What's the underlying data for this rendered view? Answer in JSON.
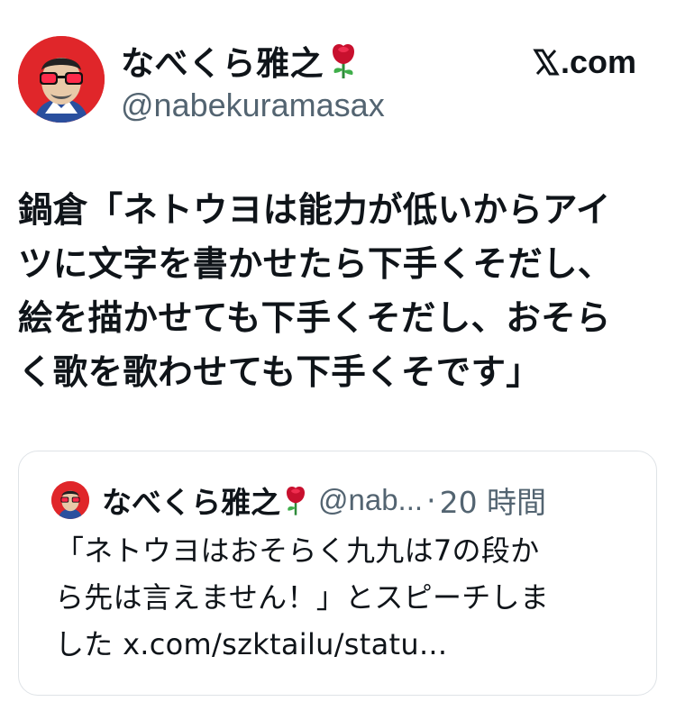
{
  "author": {
    "display_name": "なべくら雅之",
    "handle": "@nabekuramasax",
    "avatar_icon": "avatar-red-sunglasses",
    "name_emoji_icon": "rose-icon"
  },
  "source": {
    "label": ".com",
    "logo_icon": "x-logo-icon"
  },
  "tweet": {
    "lines": [
      "鍋倉「ネトウヨは能力が低いからアイ",
      "ツに文字を書かせたら下手くそだし、",
      "絵を描かせても下手くそだし、おそら",
      "く歌を歌わせても下手くそです」"
    ]
  },
  "quote": {
    "display_name": "なべくら雅之",
    "handle": "@nab...",
    "separator": "·",
    "time": "20 時間",
    "lines": [
      "「ネトウヨはおそらく九九は7の段か",
      "ら先は言えません！」とスピーチしま",
      "した x.com/szktailu/statu..."
    ]
  },
  "colors": {
    "text": "#0f1419",
    "secondary": "#536471",
    "border": "#dfe3e7",
    "avatar_red": "#e0262a"
  }
}
